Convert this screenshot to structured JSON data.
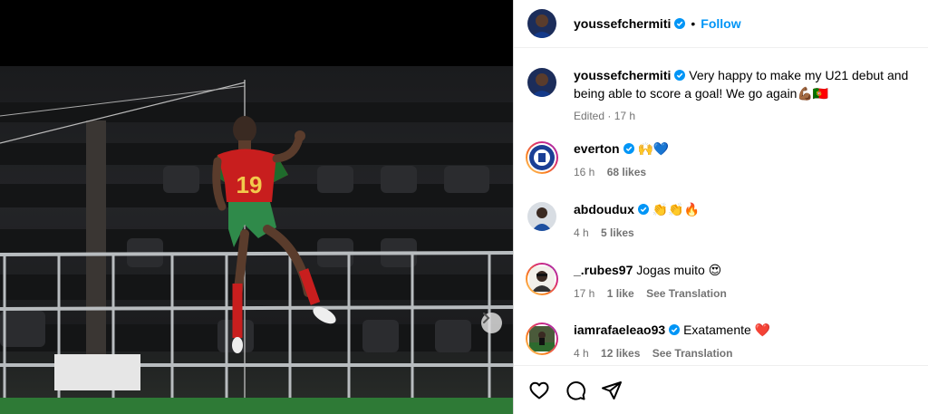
{
  "post": {
    "author": "youssefchermiti",
    "follow_label": "Follow",
    "dot": "•",
    "caption": "Very happy to make my U21 debut and being able to score a goal! We go again💪🏾🇵🇹",
    "caption_meta": "Edited · 17 h",
    "jersey_number": "19"
  },
  "comments": [
    {
      "user": "everton",
      "text": "🙌💙",
      "time": "16 h",
      "likes": "68 likes",
      "translate": ""
    },
    {
      "user": "abdoudux",
      "text": "👏👏🔥",
      "time": "4 h",
      "likes": "5 likes",
      "translate": ""
    },
    {
      "user": "_.rubes97",
      "text": "Jogas muito 😍",
      "time": "17 h",
      "likes": "1 like",
      "translate": "See Translation"
    },
    {
      "user": "iamrafaeleao93",
      "text": "Exatamente ❤️",
      "time": "4 h",
      "likes": "12 likes",
      "translate": "See Translation"
    }
  ],
  "colors": {
    "accent": "#0095f6",
    "verified": "#0095f6",
    "muted": "#737373"
  },
  "icons": {
    "like": "heart-icon",
    "comment": "comment-icon",
    "share": "share-icon",
    "next": "chevron-right-icon"
  }
}
